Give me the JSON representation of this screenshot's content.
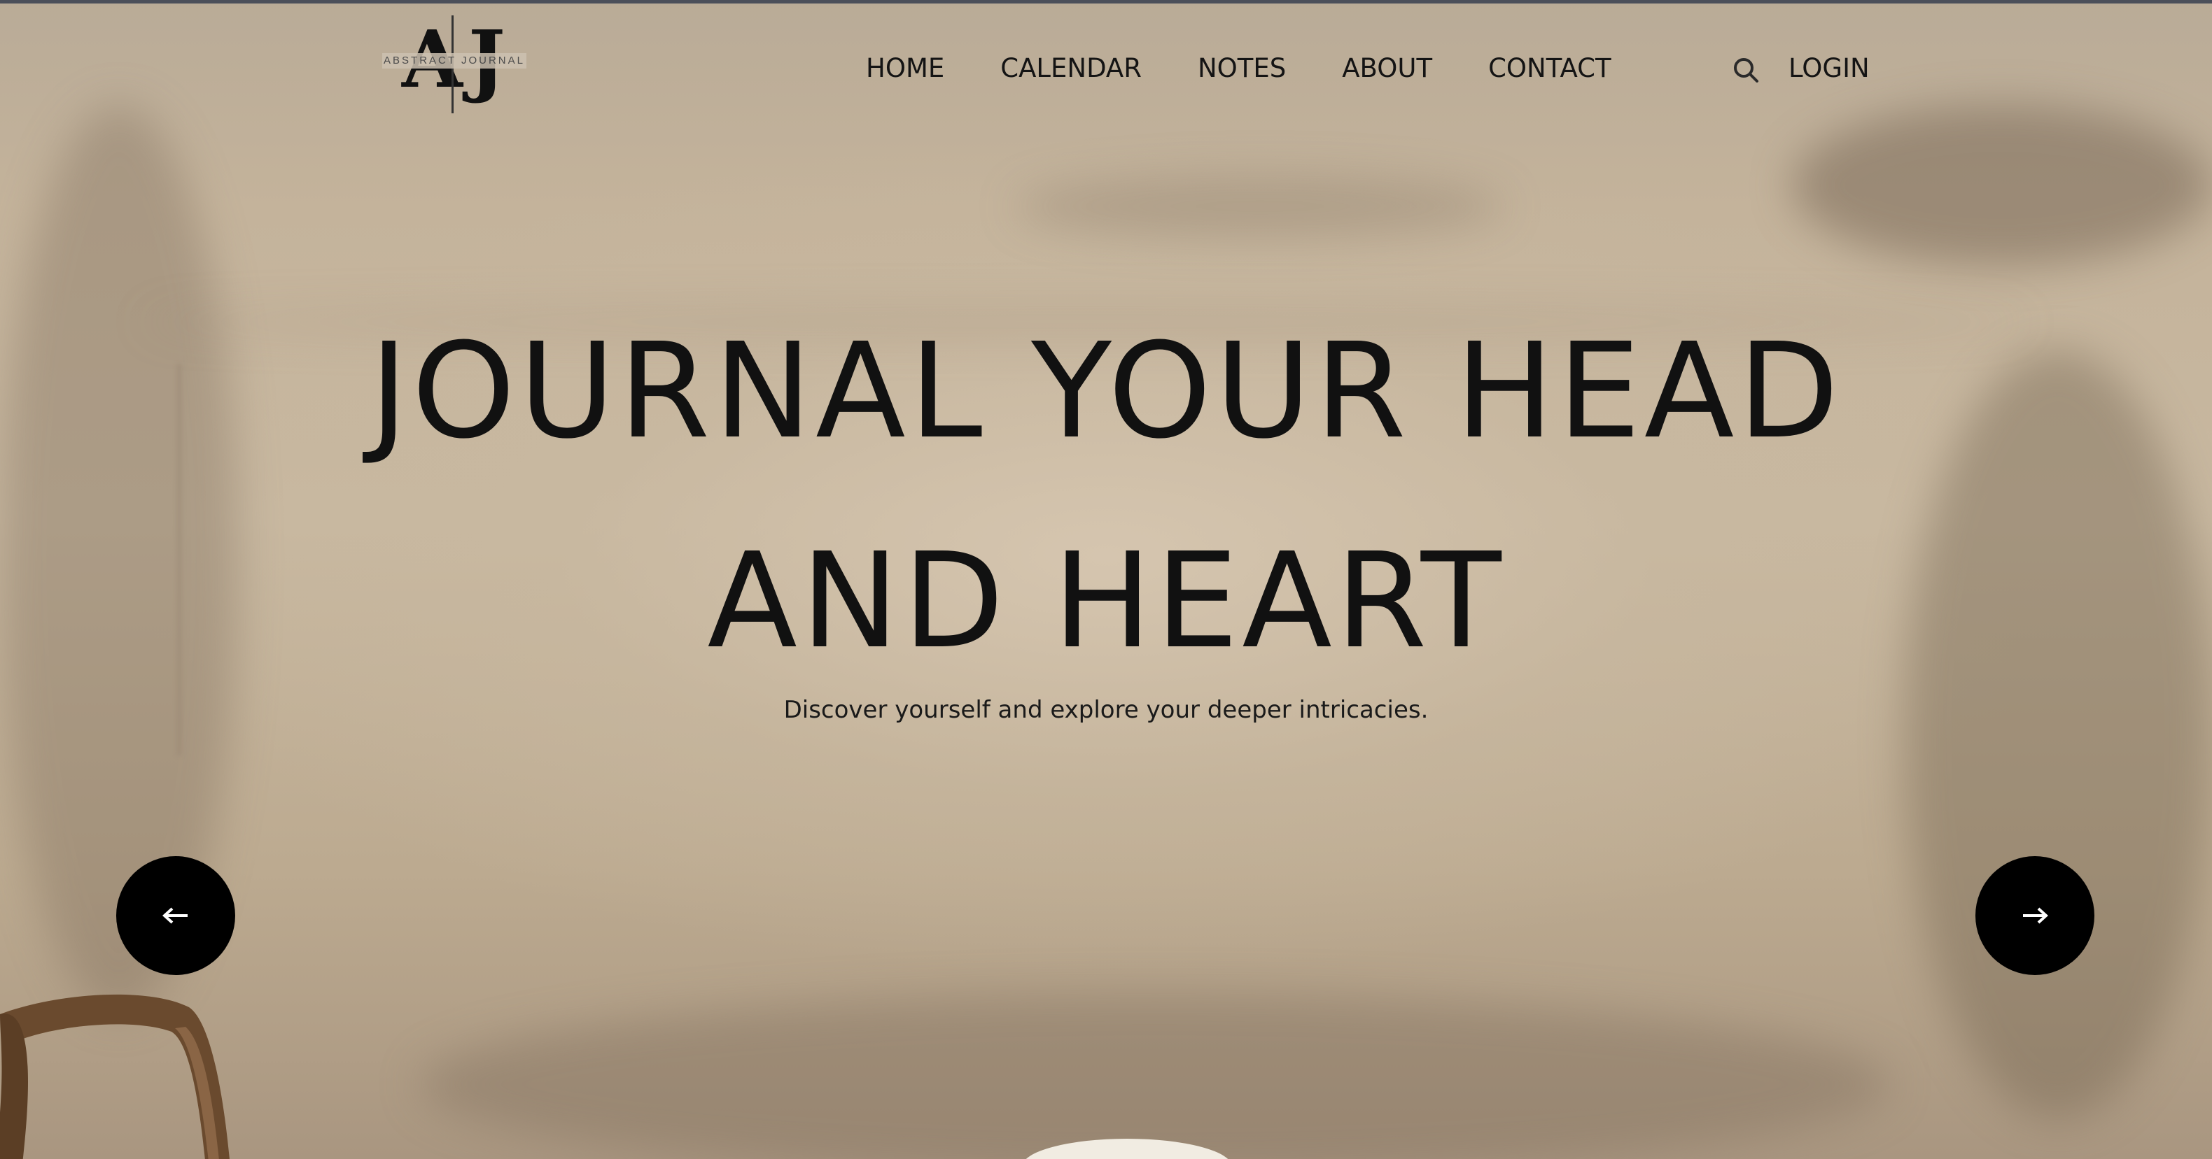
{
  "brand": {
    "monogram": "AJ",
    "name": "ABSTRACT JOURNAL"
  },
  "nav": {
    "items": [
      {
        "label": "HOME"
      },
      {
        "label": "CALENDAR"
      },
      {
        "label": "NOTES"
      },
      {
        "label": "ABOUT"
      },
      {
        "label": "CONTACT"
      }
    ],
    "search_icon": "search-icon",
    "login_label": "LOGIN"
  },
  "hero": {
    "title_line1": "JOURNAL YOUR HEAD",
    "title_line2": "AND HEART",
    "subtitle": "Discover yourself and explore your deeper intricacies.",
    "prev_icon": "arrow-left-icon",
    "next_icon": "arrow-right-icon"
  },
  "colors": {
    "text": "#141414",
    "button_bg": "#000000",
    "wall": "#c8b8a0"
  }
}
